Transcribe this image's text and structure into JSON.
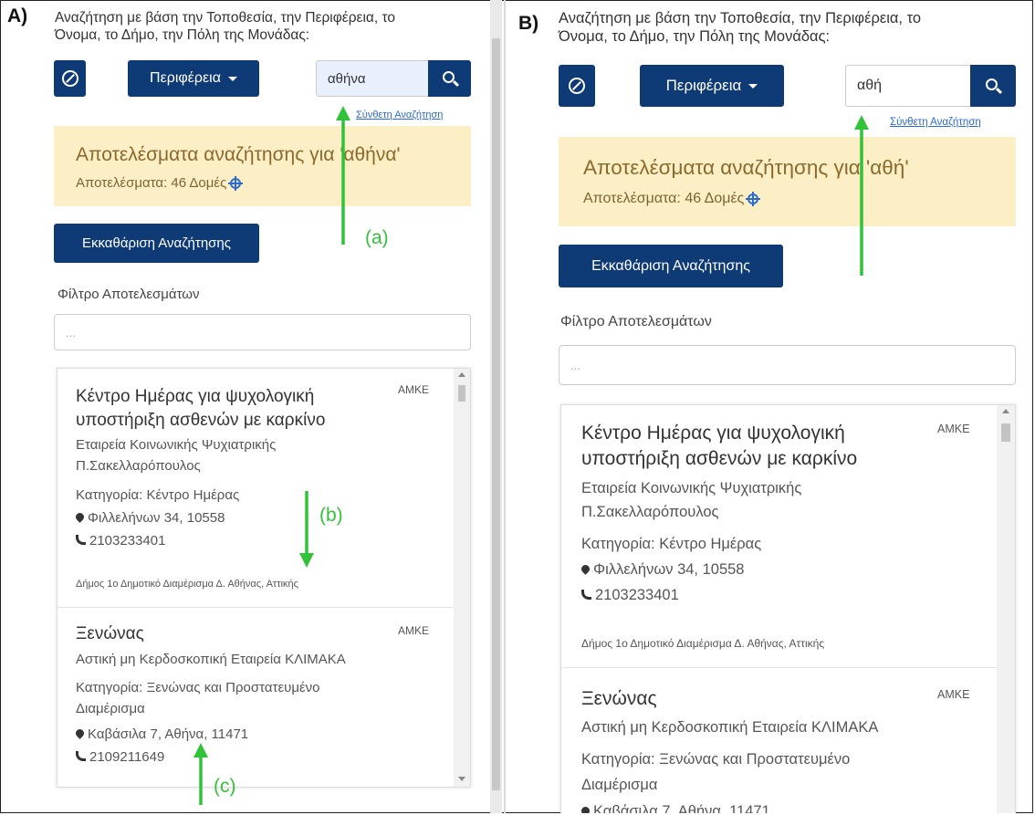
{
  "panel_a": {
    "label": "A)",
    "intro_line1": "Αναζήτηση με βάση την Τοποθεσία, την Περιφέρεια, το",
    "intro_line2": "Όνομα, το Δήμο, την Πόλη της Μονάδας:",
    "region_label": "Περιφέρεια",
    "search_value": "αθήνα",
    "advanced_link": "Σύνθετη Αναζήτηση",
    "results_title": "Αποτελέσματα αναζήτησης για 'αθήνα'",
    "results_count": "Αποτελέσματα: 46 Δομές",
    "clear_label": "Εκκαθάριση Αναζήτησης",
    "filter_label": "Φίλτρο Αποτελεσμάτων",
    "filter_placeholder": "...",
    "annotations": [
      "(a)",
      "(b)",
      "(c)"
    ]
  },
  "panel_b": {
    "label": "B)",
    "intro_line1": "Αναζήτηση με βάση την Τοποθεσία, την Περιφέρεια, το",
    "intro_line2": "Όνομα, το Δήμο, την Πόλη της Μονάδας:",
    "region_label": "Περιφέρεια",
    "search_value": "αθή",
    "advanced_link": "Σύνθετη Αναζήτηση",
    "results_title": "Αποτελέσματα αναζήτησης για 'αθή'",
    "results_count": "Αποτελέσματα: 46 Δομές",
    "clear_label": "Εκκαθάριση Αναζήτησης",
    "filter_label": "Φίλτρο Αποτελεσμάτων",
    "filter_placeholder": "..."
  },
  "cards": [
    {
      "title_line1": "Κέντρο Ημέρας για ψυχολογική",
      "title_line2": "υποστήριξη ασθενών με καρκίνο",
      "badge": "ΑΜΚΕ",
      "org_line1": "Εταιρεία Κοινωνικής Ψυχιατρικής",
      "org_line2": "Π.Σακελλαρόπουλος",
      "category": "Κατηγορία: Κέντρο Ημέρας",
      "address": "Φιλλελήνων 34, 10558",
      "phone": "2103233401",
      "municipality": "Δήμος 1ο Δημοτικό Διαμέρισμα Δ. Αθήνας, Αττικής"
    },
    {
      "title_line1": "Ξενώνας",
      "badge": "ΑΜΚΕ",
      "org_line1": "Αστική μη Κερδοσκοπική Εταιρεία ΚΛΙΜΑΚΑ",
      "category_line1": "Κατηγορία: Ξενώνας και Προστατευμένο",
      "category_line2": "Διαμέρισμα",
      "address": "Καβάσιλα 7, Αθήνα, 11471",
      "phone": "2109211649"
    }
  ],
  "colors": {
    "primary_button": "#0e3a75",
    "results_background": "#fcefc6",
    "annotation_arrow": "#31c23a",
    "link": "#2a6ad1"
  }
}
